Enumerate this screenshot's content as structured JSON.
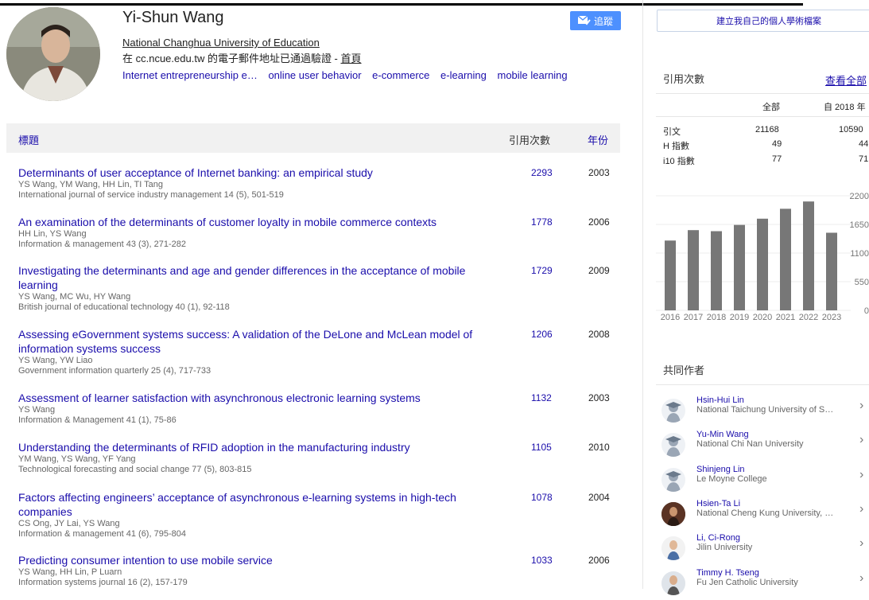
{
  "profile": {
    "name": "Yi-Shun Wang",
    "affiliation": "National Changhua University of Education",
    "email_text": "在 cc.ncue.edu.tw 的電子郵件地址已通過驗證 - ",
    "homepage": "首頁",
    "interests": [
      "Internet entrepreneurship e…",
      "online user behavior",
      "e-commerce",
      "e-learning",
      "mobile learning"
    ],
    "follow_label": "追蹤"
  },
  "table": {
    "col_title": "標題",
    "col_cited": "引用次數",
    "col_year": "年份",
    "rows": [
      {
        "title": "Determinants of user acceptance of Internet banking: an empirical study",
        "authors": "YS Wang, YM Wang, HH Lin, TI Tang",
        "venue": "International journal of service industry management 14 (5), 501-519",
        "cited": "2293",
        "year": "2003"
      },
      {
        "title": "An examination of the determinants of customer loyalty in mobile commerce contexts",
        "authors": "HH Lin, YS Wang",
        "venue": "Information & management 43 (3), 271-282",
        "cited": "1778",
        "year": "2006"
      },
      {
        "title": "Investigating the determinants and age and gender differences in the acceptance of mobile learning",
        "authors": "YS Wang, MC Wu, HY Wang",
        "venue": "British journal of educational technology 40 (1), 92-118",
        "cited": "1729",
        "year": "2009"
      },
      {
        "title": "Assessing eGovernment systems success: A validation of the DeLone and McLean model of information systems success",
        "authors": "YS Wang, YW Liao",
        "venue": "Government information quarterly 25 (4), 717-733",
        "cited": "1206",
        "year": "2008"
      },
      {
        "title": "Assessment of learner satisfaction with asynchronous electronic learning systems",
        "authors": "YS Wang",
        "venue": "Information & Management 41 (1), 75-86",
        "cited": "1132",
        "year": "2003"
      },
      {
        "title": "Understanding the determinants of RFID adoption in the manufacturing industry",
        "authors": "YM Wang, YS Wang, YF Yang",
        "venue": "Technological forecasting and social change 77 (5), 803-815",
        "cited": "1105",
        "year": "2010"
      },
      {
        "title": "Factors affecting engineers’ acceptance of asynchronous e-learning systems in high-tech companies",
        "authors": "CS Ong, JY Lai, YS Wang",
        "venue": "Information & management 41 (6), 795-804",
        "cited": "1078",
        "year": "2004"
      },
      {
        "title": "Predicting consumer intention to use mobile service",
        "authors": "YS Wang, HH Lin, P Luarn",
        "venue": "Information systems journal 16 (2), 157-179",
        "cited": "1033",
        "year": "2006"
      }
    ]
  },
  "sidebar": {
    "create_profile": "建立我自己的個人學術檔案",
    "cited_by": "引用次數",
    "view_all": "查看全部",
    "col_all": "全部",
    "col_since": "自 2018 年",
    "metrics": [
      {
        "label": "引文",
        "all": "21168",
        "since": "10590"
      },
      {
        "label": "H 指數",
        "all": "49",
        "since": "44"
      },
      {
        "label": "i10 指數",
        "all": "77",
        "since": "71"
      }
    ],
    "coauthors_title": "共同作者",
    "coauthors": [
      {
        "name": "Hsin-Hui Lin",
        "affil": "National Taichung University of S…"
      },
      {
        "name": "Yu-Min Wang",
        "affil": "National Chi Nan University"
      },
      {
        "name": "Shinjeng Lin",
        "affil": "Le Moyne College"
      },
      {
        "name": "Hsien-Ta Li",
        "affil": "National Cheng Kung University, …"
      },
      {
        "name": "Li, Ci-Rong",
        "affil": "Jilin University"
      },
      {
        "name": "Timmy H. Tseng",
        "affil": "Fu Jen Catholic University"
      }
    ]
  },
  "chart_data": {
    "type": "bar",
    "categories": [
      "2016",
      "2017",
      "2018",
      "2019",
      "2020",
      "2021",
      "2022",
      "2023"
    ],
    "values": [
      1340,
      1540,
      1520,
      1640,
      1760,
      1950,
      2090,
      1490
    ],
    "ylim": [
      0,
      2200
    ],
    "yticks": [
      "2200",
      "1650",
      "1100",
      "550",
      "0"
    ],
    "bar_color": "#777777",
    "grid": true
  },
  "colors": {
    "link": "#1a0dab",
    "button": "#4d90fe"
  }
}
